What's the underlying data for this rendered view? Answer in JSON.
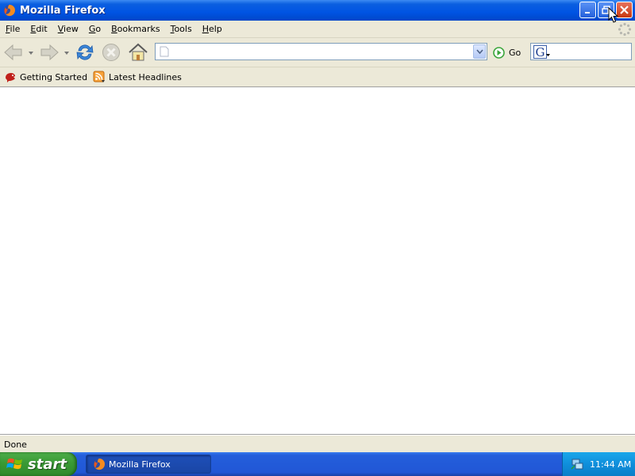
{
  "window": {
    "title": "Mozilla Firefox",
    "controls": [
      "minimize",
      "restore",
      "close"
    ]
  },
  "menubar": {
    "items": [
      {
        "label": "File",
        "accel": "F",
        "rest": "ile"
      },
      {
        "label": "Edit",
        "accel": "E",
        "rest": "dit"
      },
      {
        "label": "View",
        "accel": "V",
        "rest": "iew"
      },
      {
        "label": "Go",
        "accel": "G",
        "rest": "o"
      },
      {
        "label": "Bookmarks",
        "accel": "B",
        "rest": "ookmarks"
      },
      {
        "label": "Tools",
        "accel": "T",
        "rest": "ools"
      },
      {
        "label": "Help",
        "accel": "H",
        "rest": "elp"
      }
    ]
  },
  "navbar": {
    "url_value": "",
    "go_label": "Go",
    "search_value": "",
    "icons": [
      "back-icon",
      "forward-icon",
      "reload-icon",
      "stop-icon",
      "home-icon"
    ]
  },
  "bookmarks": {
    "items": [
      {
        "label": "Getting Started",
        "icon": "getting-started-icon"
      },
      {
        "label": "Latest Headlines",
        "icon": "rss-feed-icon"
      }
    ]
  },
  "statusbar": {
    "text": "Done"
  },
  "taskbar": {
    "start_label": "start",
    "task_label": "Mozilla Firefox",
    "clock": "11:44 AM"
  },
  "colors": {
    "titlebar": "#0054e3",
    "chrome": "#ece9d8",
    "taskbar": "#245edb",
    "start": "#3a9a35",
    "tray": "#0f8fdc"
  }
}
